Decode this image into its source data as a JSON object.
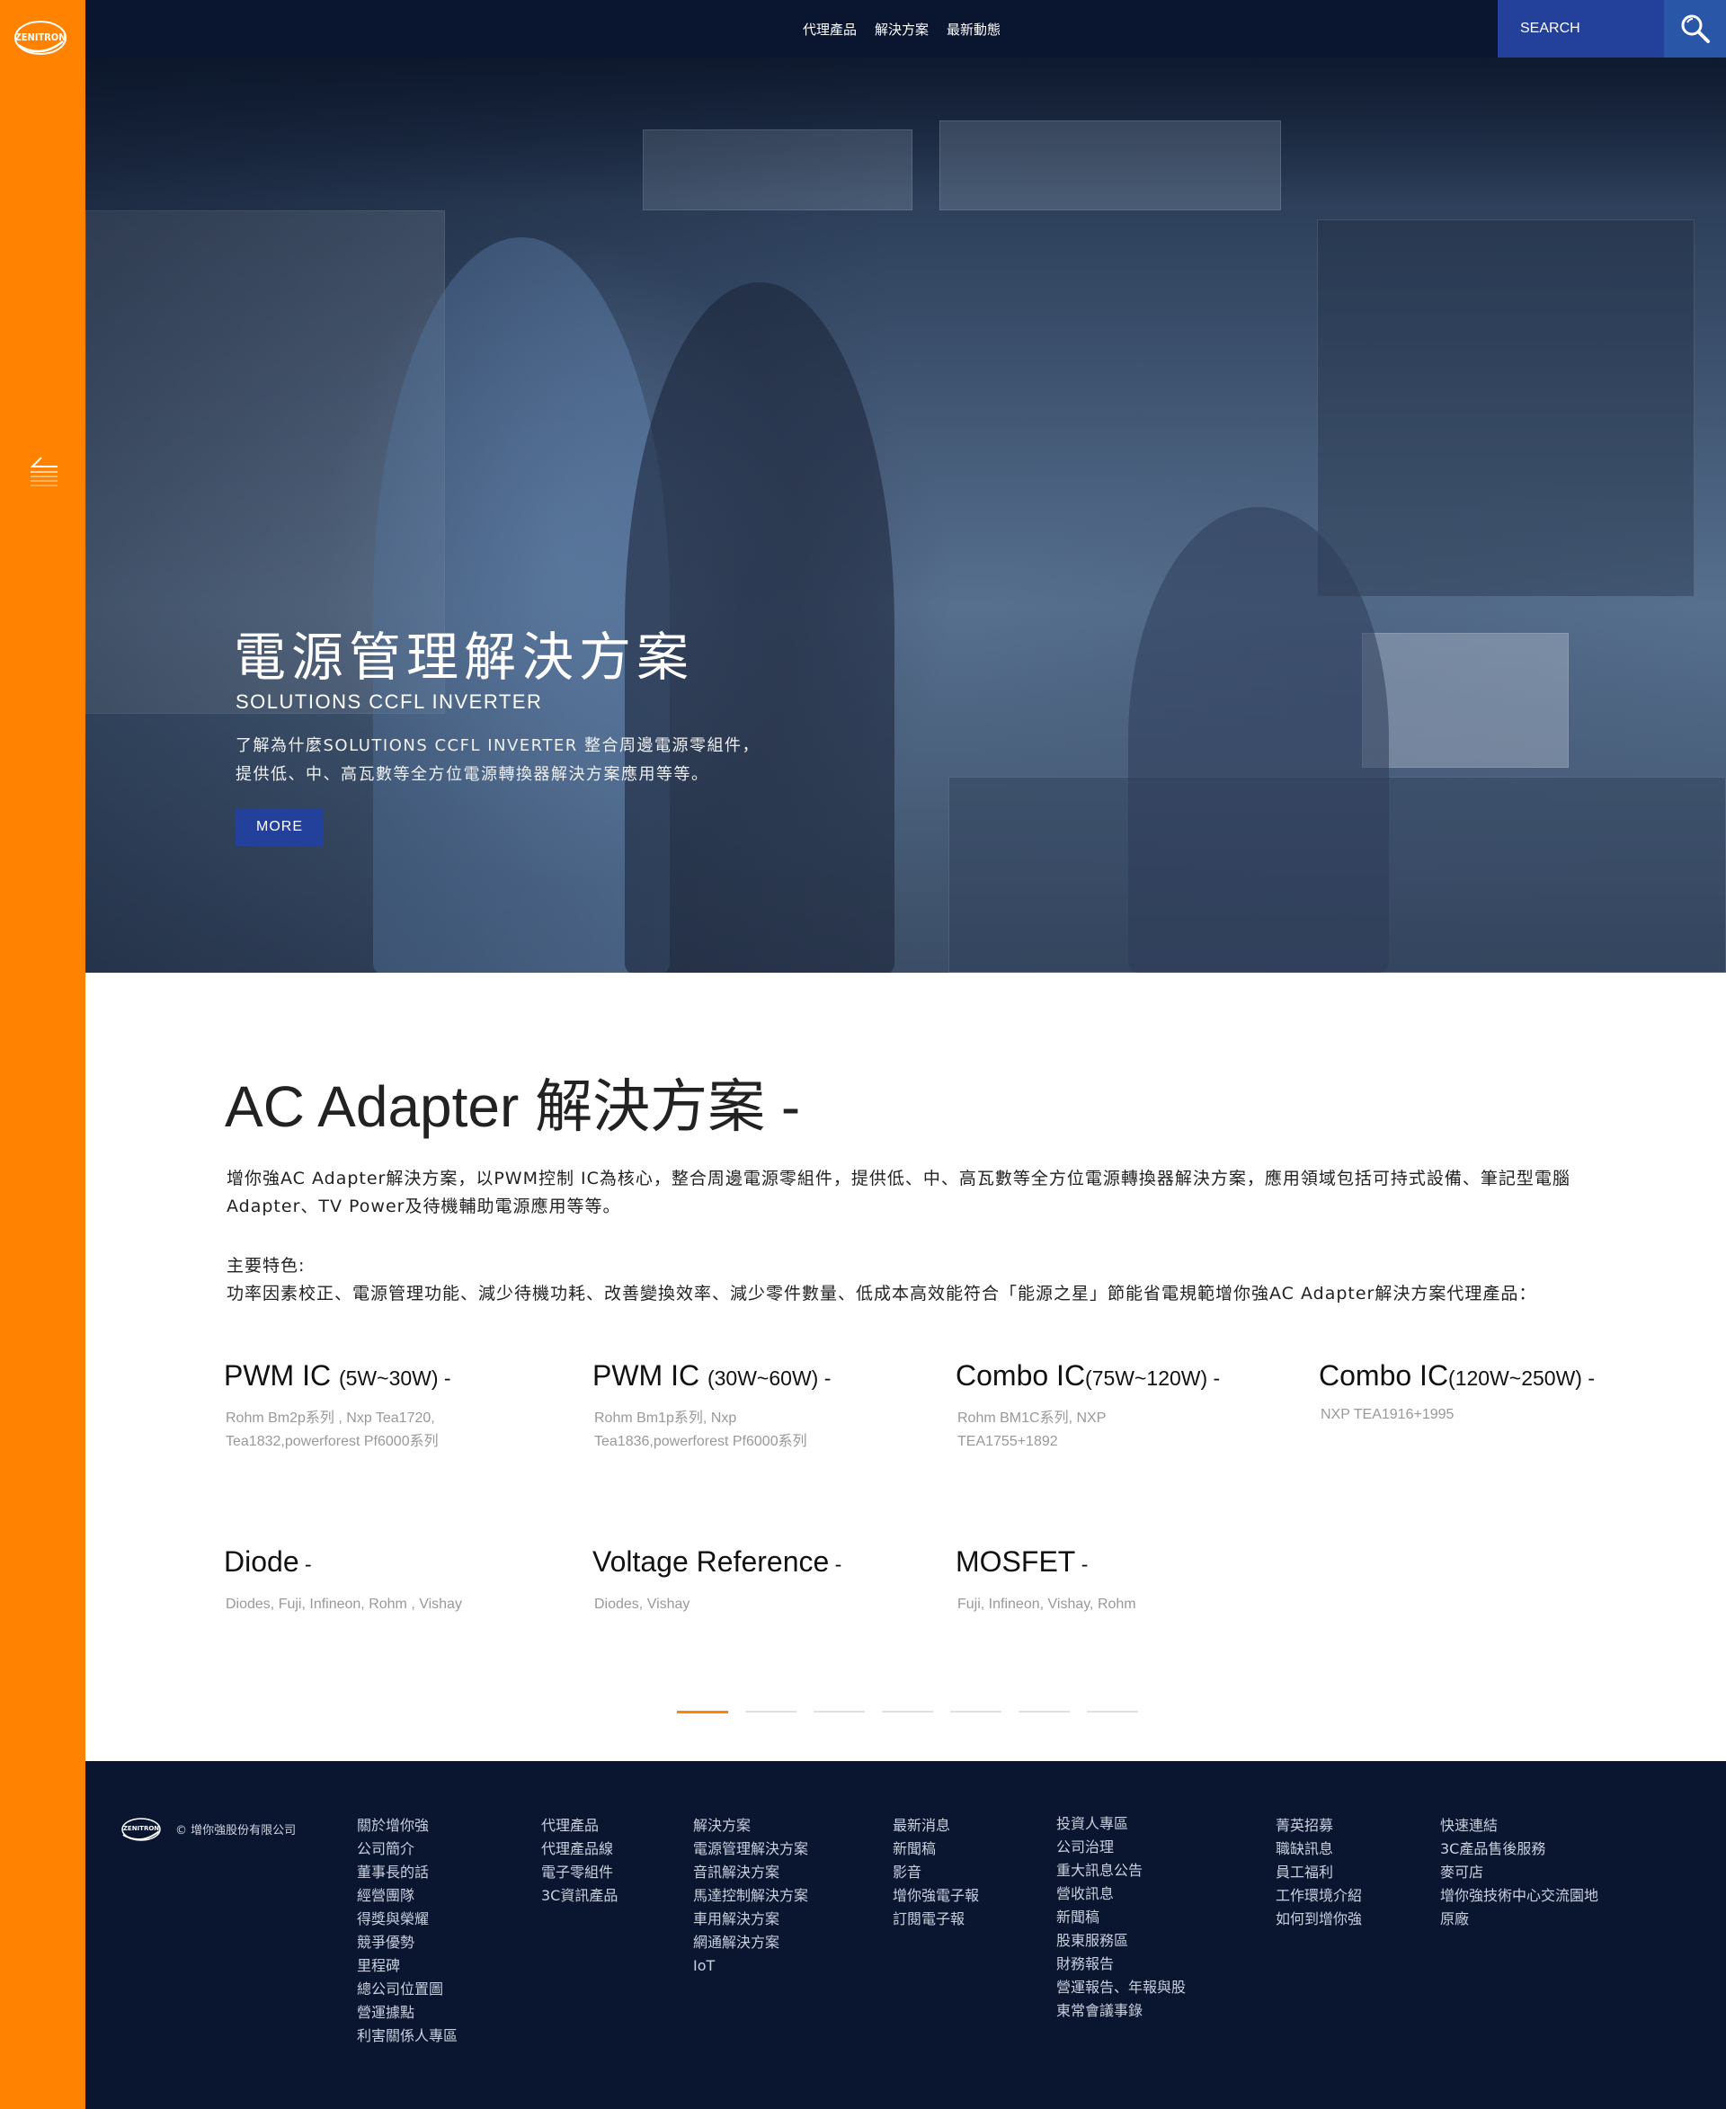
{
  "brand": {
    "logo_text": "ZENITRON"
  },
  "header": {
    "nav": [
      "代理產品",
      "解決方案",
      "最新動態"
    ],
    "search_label": "SEARCH"
  },
  "hero": {
    "title": "電源管理解決方案",
    "subtitle": "SOLUTIONS CCFL INVERTER",
    "description_line1": "了解為什麼SOLUTIONS CCFL INVERTER 整合周邊電源零組件，",
    "description_line2": "提供低、中、高瓦數等全方位電源轉換器解決方案應用等等。",
    "button": "MORE"
  },
  "section": {
    "title": "AC Adapter 解決方案 -",
    "description": "增你強AC Adapter解決方案，以PWM控制 IC為核心，整合周邊電源零組件，提供低、中、高瓦數等全方位電源轉換器解決方案，應用領域包括可持式設備、筆記型電腦Adapter、TV Power及待機輔助電源應用等等。",
    "features_label": "主要特色:",
    "features_text": "功率因素校正、電源管理功能、減少待機功耗、改善變換效率、減少零件數量、低成本高效能符合「能源之星」節能省電規範增你強AC Adapter解決方案代理產品：",
    "products": [
      {
        "name": "PWM IC",
        "range": "(5W~30W) -",
        "brands": "Rohm Bm2p系列 , Nxp Tea1720, Tea1832,powerforest Pf6000系列"
      },
      {
        "name": "PWM IC",
        "range": "(30W~60W) -",
        "brands": "Rohm Bm1p系列, Nxp Tea1836,powerforest Pf6000系列"
      },
      {
        "name": "Combo IC",
        "range": "(75W~120W) -",
        "brands": "Rohm BM1C系列, NXP TEA1755+1892"
      },
      {
        "name": "Combo IC",
        "range": "(120W~250W) -",
        "brands": "NXP TEA1916+1995"
      },
      {
        "name": "Diode",
        "range": " -",
        "brands": "Diodes, Fuji, Infineon, Rohm , Vishay"
      },
      {
        "name": "Voltage Reference",
        "range": " -",
        "brands": "Diodes, Vishay"
      },
      {
        "name": "MOSFET",
        "range": " -",
        "brands": "Fuji, Infineon, Vishay, Rohm"
      }
    ],
    "pager": {
      "pages": 7,
      "active": 1
    }
  },
  "footer": {
    "logo_text": "ZENITRON",
    "copyright": "© 增你強股份有限公司",
    "columns": [
      [
        "關於增你強",
        "公司簡介",
        "董事長的話",
        "經營團隊",
        "得獎與榮耀",
        "競爭優勢",
        "里程碑",
        "總公司位置圖",
        "營運據點",
        "利害關係人專區"
      ],
      [
        "代理產品",
        "代理產品線",
        "電子零組件",
        "3C資訊產品"
      ],
      [
        "解決方案",
        "電源管理解決方案",
        "音訊解決方案",
        "馬達控制解決方案",
        "車用解決方案",
        "網通解決方案",
        "IoT"
      ],
      [
        "最新消息",
        "新聞稿",
        "影音",
        "增你強電子報",
        "訂閱電子報"
      ],
      [
        "投資人專區",
        "公司治理",
        "重大訊息公告",
        "營收訊息",
        "新聞稿",
        "股東服務區",
        "財務報告",
        "營運報告、年報與股",
        "東常會議事錄"
      ],
      [
        "菁英招募",
        "職缺訊息",
        "員工福利",
        "工作環境介紹",
        "如何到增你強"
      ],
      [
        "快速連結",
        "3C產品售後服務",
        "麥可店",
        "增你強技術中心交流園地",
        "原廠"
      ]
    ]
  },
  "colors": {
    "accent": "#ff8200",
    "navy": "#0a1530",
    "button_blue": "#23409a"
  }
}
